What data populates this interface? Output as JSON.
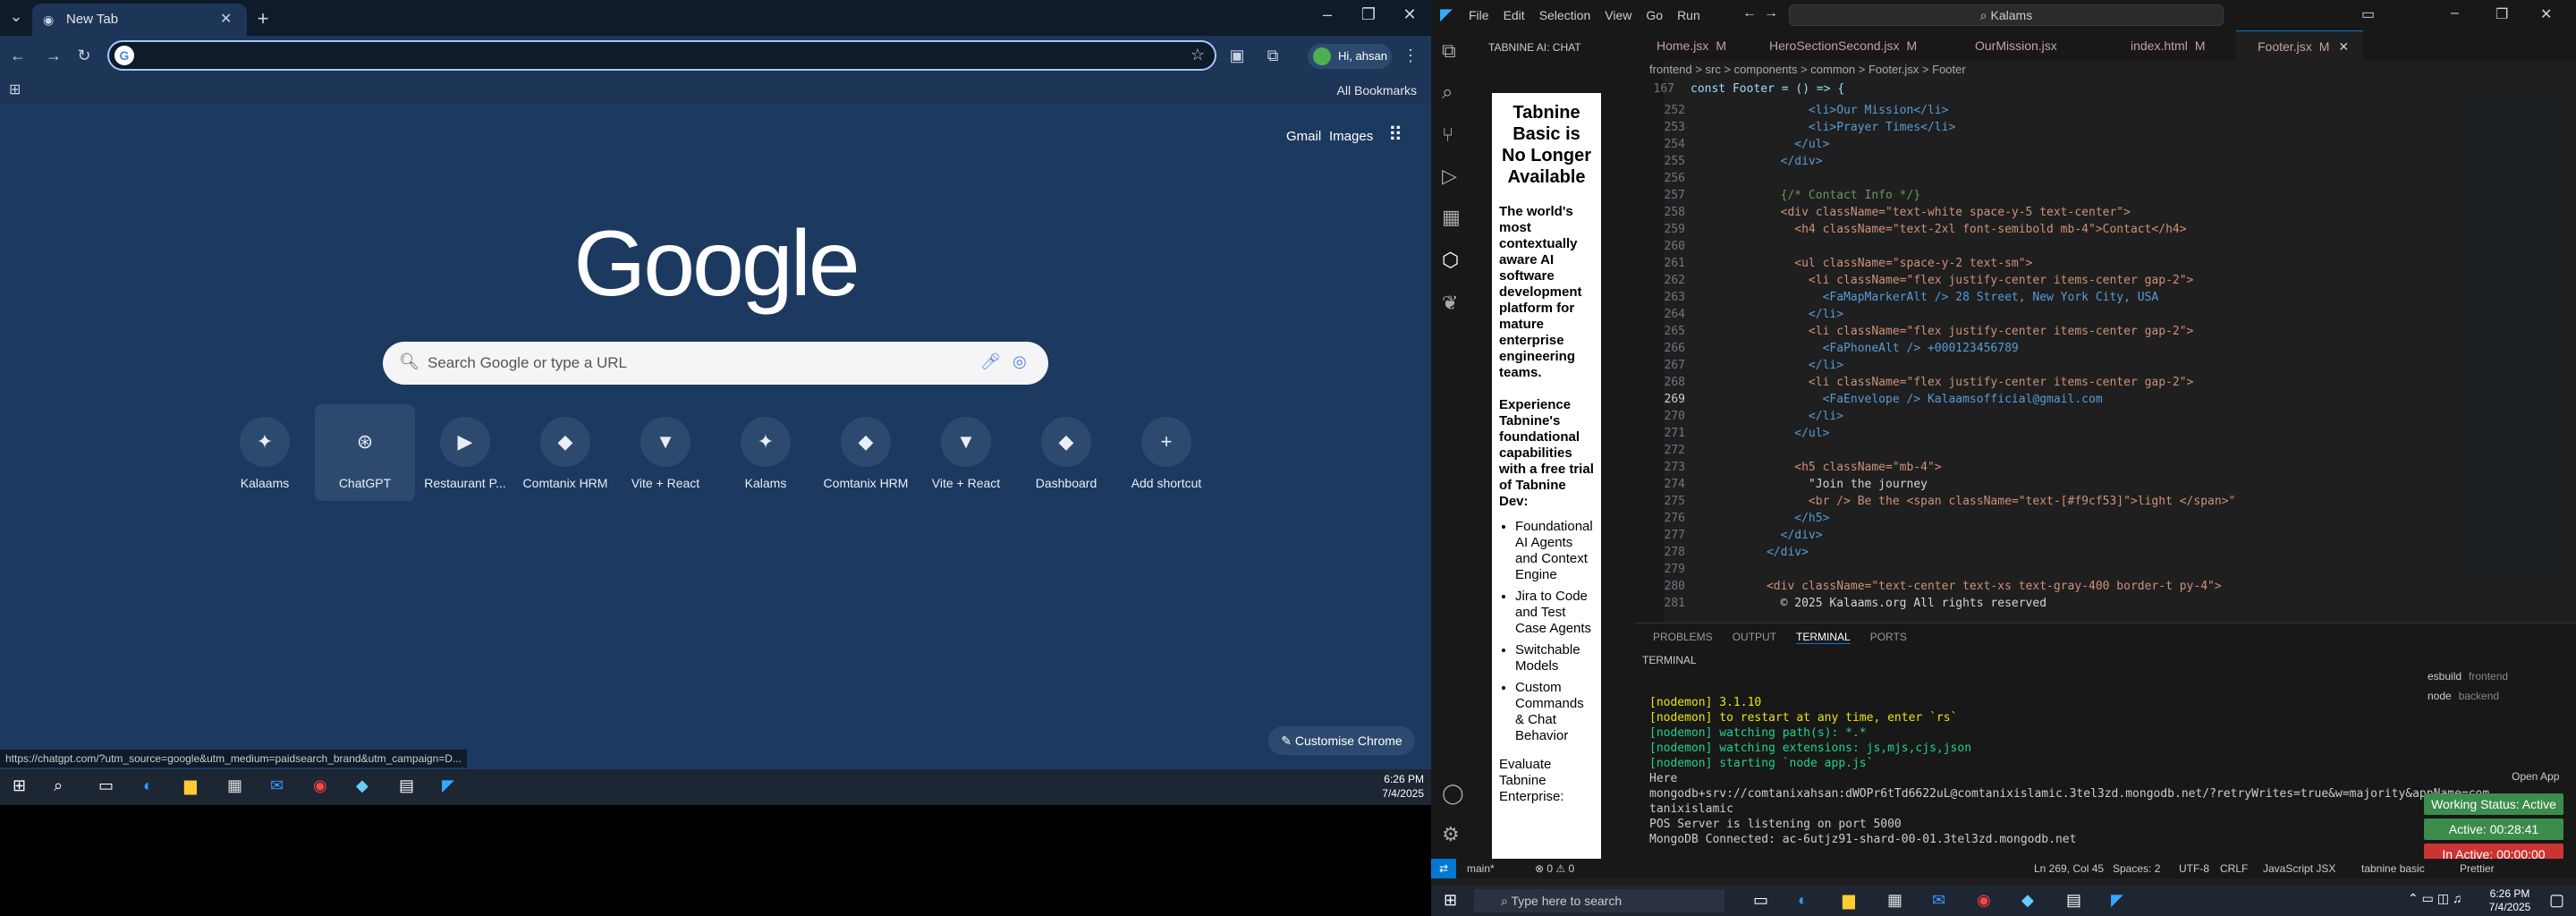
{
  "chrome": {
    "tab_title": "New Tab",
    "bookmarks": "All Bookmarks",
    "gmail": "Gmail",
    "images": "Images",
    "account": "Hi, ahsan",
    "logo": "Google",
    "search_placeholder": "Search Google or type a URL",
    "customise": "Customise Chrome",
    "status_url": "https://chatgpt.com/?utm_source=google&utm_medium=paidsearch_brand&utm_campaign=D...",
    "shortcuts": [
      "Kalaams",
      "ChatGPT",
      "Restaurant P...",
      "Comtanix HRM",
      "Vite + React",
      "Kalams",
      "Comtanix HRM",
      "Vite + React",
      "Dashboard",
      "Add shortcut"
    ]
  },
  "taskbar_left": {
    "time": "6:26 PM",
    "date": "7/4/2025"
  },
  "vscode": {
    "title_menus": [
      "File",
      "Edit",
      "Selection",
      "View",
      "Go",
      "Run"
    ],
    "search": "Kalams",
    "chat_title": "TABNINE AI: CHAT",
    "chat": {
      "head": "Tabnine Basic is No Longer Available",
      "p1": "The world's most contextually aware AI software development platform for mature enterprise engineering teams.",
      "p2": "Experience Tabnine's foundational capabilities with a free trial of Tabnine Dev:",
      "bullets": [
        "Foundational AI Agents and Context Engine",
        "Jira to Code and Test Case Agents",
        "Switchable Models",
        "Custom Commands & Chat Behavior"
      ],
      "p3": "Evaluate Tabnine Enterprise:"
    },
    "tabs": [
      {
        "name": "Home.jsx",
        "mark": "M"
      },
      {
        "name": "HeroSectionSecond.jsx",
        "mark": "M"
      },
      {
        "name": "OurMission.jsx",
        "mark": ""
      },
      {
        "name": "index.html",
        "mark": "M"
      },
      {
        "name": "Footer.jsx",
        "mark": "M"
      }
    ],
    "breadcrumb": "frontend > src > components > common > Footer.jsx > Footer",
    "sticky": "const Footer = () => {",
    "lines": [
      {
        "n": "252",
        "t": "            <li>Our Mission</li>"
      },
      {
        "n": "253",
        "t": "            <li>Prayer Times</li>"
      },
      {
        "n": "254",
        "t": "          </ul>"
      },
      {
        "n": "255",
        "t": "        </div>"
      },
      {
        "n": "256",
        "t": ""
      },
      {
        "n": "257",
        "t": "        {/* Contact Info */}"
      },
      {
        "n": "258",
        "t": "        <div className=\"text-white space-y-5 text-center\">"
      },
      {
        "n": "259",
        "t": "          <h4 className=\"text-2xl font-semibold mb-4\">Contact</h4>"
      },
      {
        "n": "260",
        "t": ""
      },
      {
        "n": "261",
        "t": "          <ul className=\"space-y-2 text-sm\">"
      },
      {
        "n": "262",
        "t": "            <li className=\"flex justify-center items-center gap-2\">"
      },
      {
        "n": "263",
        "t": "              <FaMapMarkerAlt /> 28 Street, New York City, USA"
      },
      {
        "n": "264",
        "t": "            </li>"
      },
      {
        "n": "265",
        "t": "            <li className=\"flex justify-center items-center gap-2\">"
      },
      {
        "n": "266",
        "t": "              <FaPhoneAlt /> +000123456789"
      },
      {
        "n": "267",
        "t": "            </li>"
      },
      {
        "n": "268",
        "t": "            <li className=\"flex justify-center items-center gap-2\">"
      },
      {
        "n": "269",
        "t": "              <FaEnvelope /> Kalaamsofficial@gmail.com"
      },
      {
        "n": "270",
        "t": "            </li>"
      },
      {
        "n": "271",
        "t": "          </ul>"
      },
      {
        "n": "272",
        "t": ""
      },
      {
        "n": "273",
        "t": "          <h5 className=\"mb-4\">"
      },
      {
        "n": "274",
        "t": "            \"Join the journey"
      },
      {
        "n": "275",
        "t": "            <br /> Be the <span className=\"text-[#f9cf53]\">light </span>\""
      },
      {
        "n": "276",
        "t": "          </h5>"
      },
      {
        "n": "277",
        "t": "        </div>"
      },
      {
        "n": "278",
        "t": "      </div>"
      },
      {
        "n": "279",
        "t": ""
      },
      {
        "n": "280",
        "t": "      <div className=\"text-center text-xs text-gray-400 border-t py-4\">"
      },
      {
        "n": "281",
        "t": "        © 2025 Kalaams.org All rights reserved"
      }
    ],
    "panel_tabs": [
      "PROBLEMS",
      "OUTPUT",
      "TERMINAL",
      "PORTS"
    ],
    "terminal_label": "TERMINAL",
    "terminal": [
      "[nodemon] 3.1.10",
      "[nodemon] to restart at any time, enter `rs`",
      "[nodemon] watching path(s): *.*",
      "[nodemon] watching extensions: js,mjs,cjs,json",
      "[nodemon] starting `node app.js`",
      "Here",
      "mongodb+srv://comtanixahsan:dWOPr6tTd6622uL@comtanixislamic.3tel3zd.mongodb.net/?retryWrites=true&w=majority&appName=com",
      "tanixislamic",
      "POS Server is listening on port 5000",
      "MongoDB Connected: ac-6utjz91-shard-00-01.3tel3zd.mongodb.net"
    ],
    "terms": [
      {
        "name": "esbuild",
        "dir": "frontend"
      },
      {
        "name": "node",
        "dir": "backend"
      }
    ],
    "open_app": "Open App",
    "working": "Working Status: Active",
    "active": "Active: 00:28:41",
    "inactive": "In Active: 00:00:00",
    "status": {
      "branch": "main*",
      "errors": "0",
      "warnings": "0",
      "pos": "Ln 269, Col 45",
      "spaces": "Spaces: 2",
      "enc": "UTF-8",
      "eol": "CRLF",
      "lang": "JavaScript JSX",
      "tabnine": "tabnine basic",
      "prettier": "Prettier"
    }
  },
  "taskbar_right": {
    "search": "Type here to search",
    "time": "6:26 PM",
    "date": "7/4/2025"
  }
}
